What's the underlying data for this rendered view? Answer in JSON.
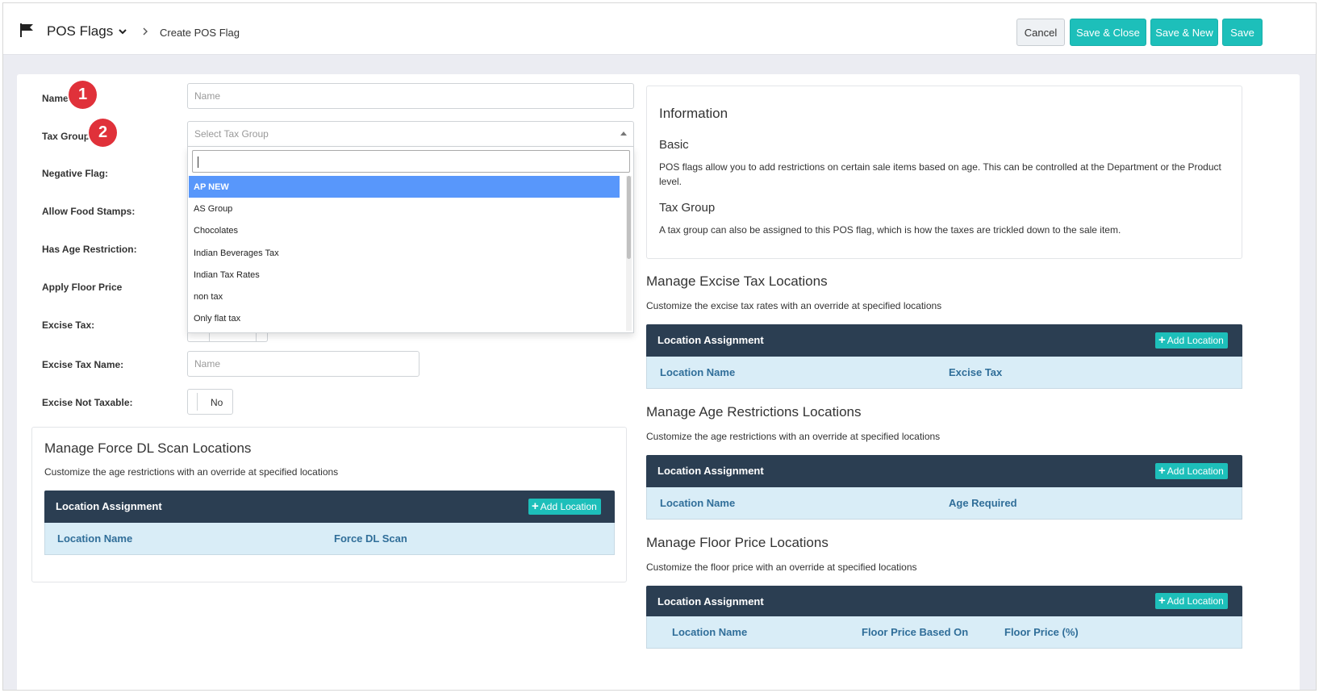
{
  "header": {
    "title": "POS Flags",
    "breadcrumb": "Create POS Flag",
    "buttons": {
      "cancel": "Cancel",
      "save_close": "Save & Close",
      "save_new": "Save & New",
      "save": "Save"
    },
    "accent_color": "#1dbfba"
  },
  "form": {
    "name_label": "Name: *",
    "name_placeholder": "Name",
    "tax_group_label": "Tax Group: *",
    "tax_group_placeholder": "Select Tax Group",
    "negative_flag_label": "Negative Flag:",
    "food_stamps_label": "Allow Food Stamps:",
    "age_restriction_label": "Has Age Restriction:",
    "floor_price_label": "Apply Floor Price",
    "excise_tax_label": "Excise Tax:",
    "excise_tax_name_label": "Excise Tax Name:",
    "excise_tax_name_placeholder": "Name",
    "excise_not_taxable_label": "Excise Not Taxable:",
    "excise_not_taxable_value": "No",
    "badges": [
      "1",
      "2"
    ]
  },
  "tax_group_dropdown": {
    "search_value": "",
    "options": [
      "AP NEW",
      "AS Group",
      "Chocolates",
      "Indian Beverages Tax",
      "Indian Tax Rates",
      "non tax",
      "Only flat tax"
    ],
    "highlighted": "AP NEW"
  },
  "force_dl": {
    "title": "Manage Force DL Scan Locations",
    "subtitle": "Customize the age restrictions with an override at specified locations",
    "table_title": "Location Assignment",
    "add_label": "Add Location",
    "columns": [
      "Location Name",
      "Force DL Scan"
    ]
  },
  "information": {
    "title": "Information",
    "basic_heading": "Basic",
    "basic_text": "POS flags allow you to add restrictions on certain sale items based on age. This can be controlled at the Department or the Product level.",
    "tax_heading": "Tax Group",
    "tax_text": "A tax group can also be assigned to this POS flag, which is how the taxes are trickled down to the sale item."
  },
  "excise": {
    "title": "Manage Excise Tax Locations",
    "subtitle": "Customize the excise tax rates with an override at specified locations",
    "table_title": "Location Assignment",
    "add_label": "Add Location",
    "columns": [
      "Location Name",
      "Excise Tax"
    ]
  },
  "age": {
    "title": "Manage Age Restrictions Locations",
    "subtitle": "Customize the age restrictions with an override at specified locations",
    "table_title": "Location Assignment",
    "add_label": "Add Location",
    "columns": [
      "Location Name",
      "Age Required"
    ]
  },
  "floor": {
    "title": "Manage Floor Price Locations",
    "subtitle": "Customize the floor price with an override at specified locations",
    "table_title": "Location Assignment",
    "add_label": "Add Location",
    "columns": [
      "Location Name",
      "Floor Price Based On",
      "Floor Price (%)"
    ]
  }
}
